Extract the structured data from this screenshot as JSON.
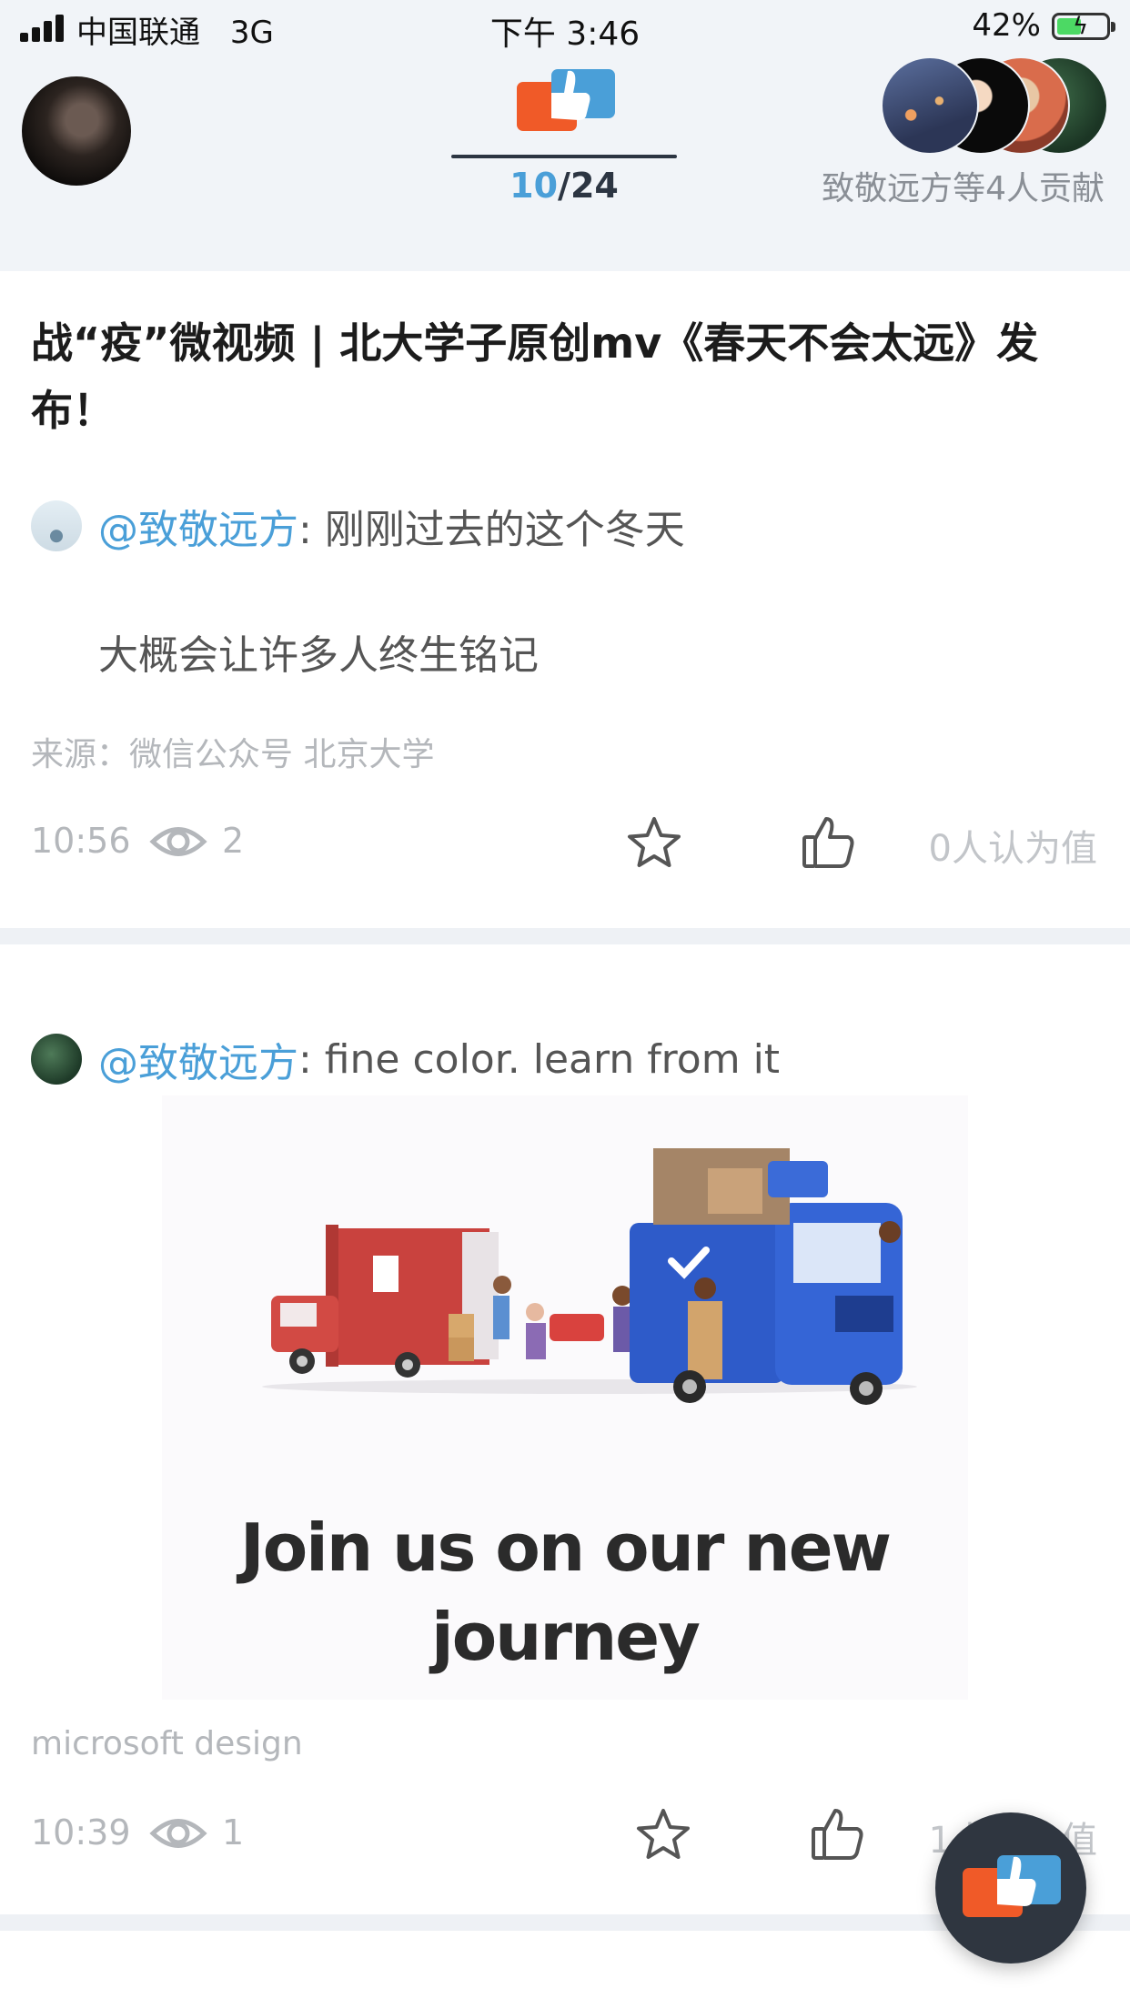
{
  "status_bar": {
    "carrier": "中国联通",
    "network": "3G",
    "time": "下午 3:46",
    "battery": "42%"
  },
  "header": {
    "counter_current": "10",
    "counter_separator": "/",
    "counter_total": "24",
    "contributors_text": "致敬远方等4人贡献"
  },
  "posts": [
    {
      "title": "战“疫”微视频 | 北大学子原创mv《春天不会太远》发布！",
      "mention": "@致敬远方",
      "text_line1": ": 刚刚过去的这个冬天",
      "text_line2": "大概会让许多人终生铭记",
      "source": "来源：微信公众号 北京大学",
      "time": "10:56",
      "views": "2",
      "worth": "0人认为值"
    },
    {
      "mention": "@致敬远方",
      "text_line1": ": fine color. learn from it",
      "image_headline": "Join us on our new journey",
      "source": "microsoft design",
      "time": "10:39",
      "views": "1",
      "worth": "1人认为值"
    }
  ],
  "icons": {
    "signal": "signal-bars-icon",
    "battery": "battery-charging-icon",
    "logo": "thumbs-up-logo-icon",
    "views": "eye-icon",
    "favorite": "star-outline-icon",
    "like": "thumbs-up-outline-icon"
  },
  "colors": {
    "accent_blue": "#4a9fd8",
    "logo_orange": "#f05a28",
    "header_bg": "#f1f4f8",
    "muted_text": "#b4b7bb"
  }
}
